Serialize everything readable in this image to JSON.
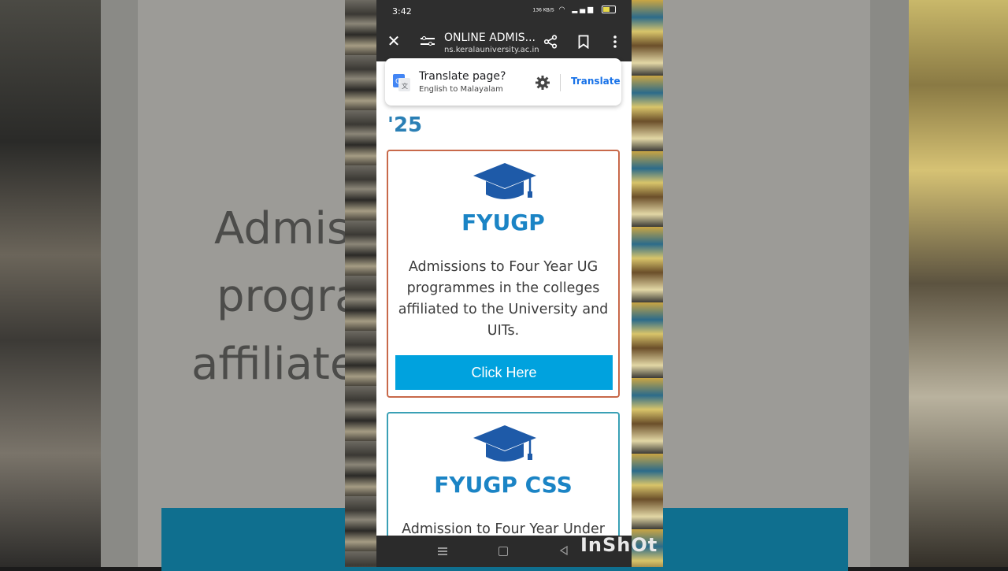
{
  "status_bar": {
    "time": "3:42",
    "net_speed": "136 KB/S",
    "battery_pct": 0.6
  },
  "browser": {
    "title": "ONLINE ADMIS...",
    "url": "ns.keralauniversity.ac.in",
    "icons": [
      "close-icon",
      "tune-icon",
      "share-icon",
      "bookmark-icon",
      "more-icon"
    ]
  },
  "translate": {
    "title": "Translate page?",
    "subtitle": "English to Malayalam",
    "action": "Translate"
  },
  "page": {
    "heading_tail": "'25",
    "cards": [
      {
        "title": "FYUGP",
        "description": "Admissions to Four Year UG programmes in the colleges affiliated to the University and UITs.",
        "button": "Click Here"
      },
      {
        "title": "FYUGP CSS",
        "description": "Admission to Four Year Under"
      }
    ]
  },
  "background": {
    "line1": "Admis        ear UG",
    "line2": "progra         olleges",
    "line3": "affiliate          sity and"
  },
  "watermark": "InShOt",
  "colors": {
    "accent": "#1b84c5",
    "button": "#00a2de",
    "card1_border": "#c8694a",
    "card2_border": "#3aa0b5"
  }
}
